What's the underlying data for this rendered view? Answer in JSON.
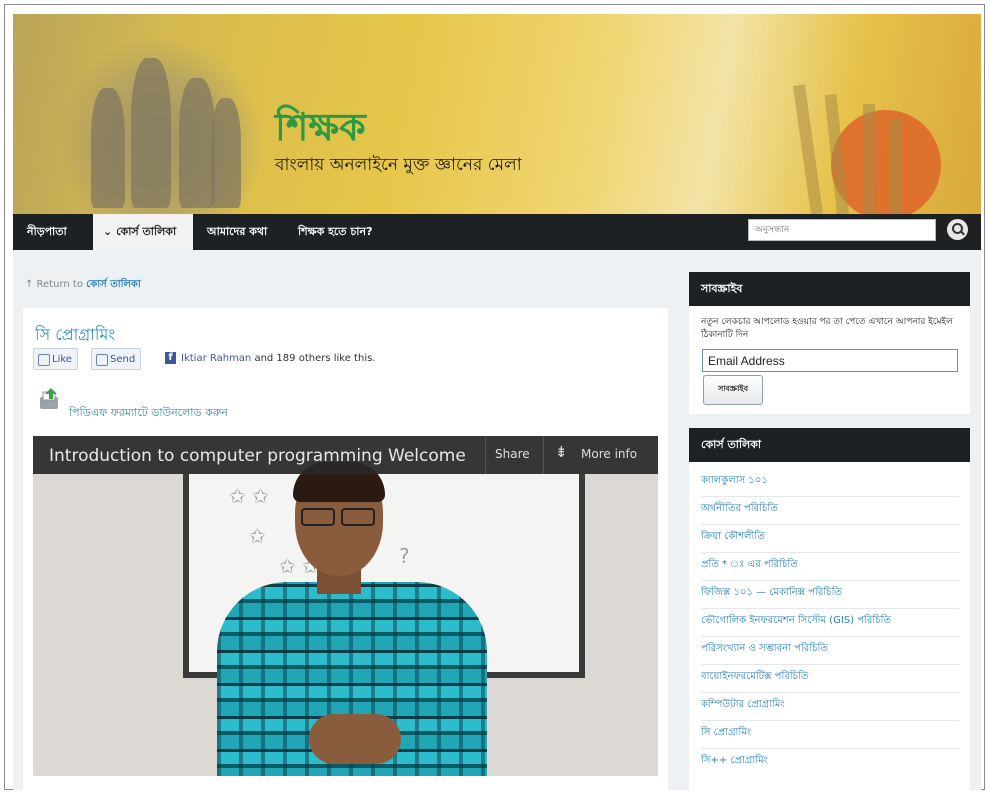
{
  "header": {
    "site_title": "শিক্ষক",
    "tagline": "বাংলায় অনলাইনে মুক্ত জ্ঞানের মেলা"
  },
  "nav": {
    "items": [
      {
        "label": "নীড়পাতা"
      },
      {
        "label": "কোর্স তালিকা",
        "active": true
      },
      {
        "label": "আমাদের কথা"
      },
      {
        "label": "শিক্ষক হতে চান?"
      }
    ],
    "search_placeholder": "অনুসন্ধান"
  },
  "breadcrumb": {
    "prefix": "↑ Return to",
    "link": "কোর্স তালিকা"
  },
  "post": {
    "title": "সি প্রোগ্রামিং",
    "like_label": "Like",
    "send_label": "Send",
    "likes_name": "Iktiar Rahman",
    "likes_rest": " and 189 others like this.",
    "pdf_link": "পিডিএফ ফরম্যাটে ডাউনলোড করুন",
    "video": {
      "title": "Introduction to computer programming   Welcome",
      "share": "Share",
      "more": "More info"
    }
  },
  "subscribe": {
    "heading": "সাবস্ক্রাইব",
    "text": "নতুন লেকচার আপলোড হওয়ার পর তা পেতে এখানে আপনার ইমেইল ঠিকানাটি দিন",
    "email_value": "Email Address",
    "button": "সাবস্ক্রাইব"
  },
  "courses": {
    "heading": "কোর্স তালিকা",
    "items": [
      "ক্যালকুলাস ১০১",
      "অর্থনীতির পরিচিতি",
      "ক্রিয়া কৌশলীতি",
      "প্রতি * ঃ এর পরিচিতি",
      "ফিজিক্স ১০১ — মেকানিক্স পরিচিতি",
      "ভৌগোলিক ইনফরমেশন সিস্টেম (GIS) পরিচিতি",
      "পরিসংখ্যান ও সম্ভাবনা পরিচিতি",
      "বায়োইনফরমেটিক্স পরিচিতি",
      "কম্পিউটার প্রোগ্রামিং",
      "সি প্রোগ্রামিং",
      "সি++ প্রোগ্রামিং"
    ]
  },
  "colors": {
    "accent_green": "#2c9a45",
    "nav_dark": "#1d2124",
    "link_blue": "#2a7fb8"
  }
}
